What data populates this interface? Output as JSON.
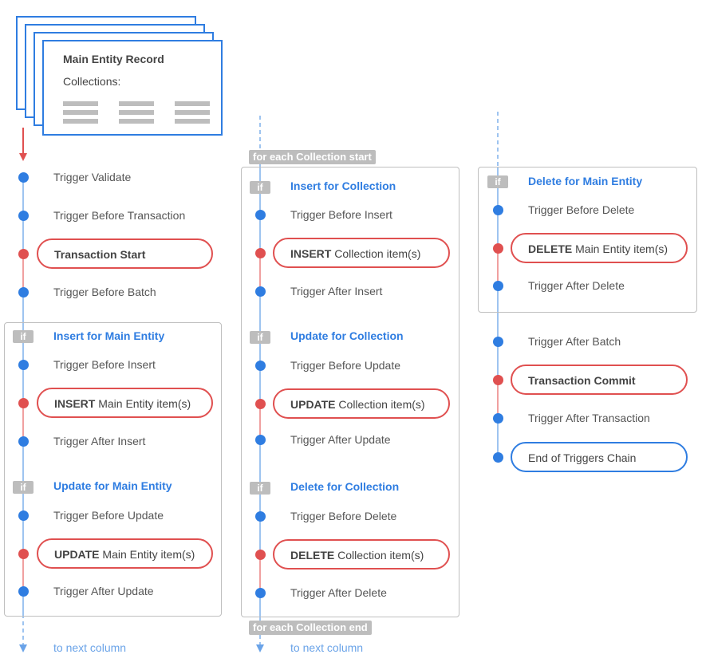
{
  "record": {
    "title": "Main Entity Record",
    "subtitle": "Collections:"
  },
  "col1": {
    "validate": "Trigger Validate",
    "before_transaction": "Trigger Before Transaction",
    "transaction_start": "Transaction Start",
    "before_batch": "Trigger Before Batch",
    "if_label": "if",
    "insert_title": "Insert for Main Entity",
    "before_insert": "Trigger Before Insert",
    "insert_bold": "INSERT",
    "insert_rest": "Main Entity item(s)",
    "after_insert": "Trigger After Insert",
    "update_title": "Update for Main Entity",
    "before_update": "Trigger Before Update",
    "update_bold": "UPDATE",
    "update_rest": "Main Entity item(s)",
    "after_update": "Trigger After Update",
    "next": "to next column"
  },
  "col2": {
    "foreach_start": "for each Collection start",
    "foreach_end": "for each Collection end",
    "if_label": "if",
    "insert_title": "Insert for Collection",
    "before_insert": "Trigger Before Insert",
    "insert_bold": "INSERT",
    "insert_rest": "Collection item(s)",
    "after_insert": "Trigger After Insert",
    "update_title": "Update for Collection",
    "before_update": "Trigger Before Update",
    "update_bold": "UPDATE",
    "update_rest": "Collection item(s)",
    "after_update": "Trigger After Update",
    "delete_title": "Delete for Collection",
    "before_delete": "Trigger Before Delete",
    "delete_bold": "DELETE",
    "delete_rest": "Collection item(s)",
    "after_delete": "Trigger After Delete",
    "next": "to next column"
  },
  "col3": {
    "if_label": "if",
    "delete_title": "Delete for Main Entity",
    "before_delete": "Trigger Before Delete",
    "delete_bold": "DELETE",
    "delete_rest": "Main Entity item(s)",
    "after_delete": "Trigger After Delete",
    "after_batch": "Trigger After Batch",
    "commit": "Transaction Commit",
    "after_transaction": "Trigger After Transaction",
    "end": "End of Triggers Chain"
  },
  "colors": {
    "blue": "#2f7de1",
    "red": "#e05050",
    "light_blue": "#9ec4f0",
    "light_red": "#f0a0a0",
    "gray": "#bdbdbd"
  }
}
